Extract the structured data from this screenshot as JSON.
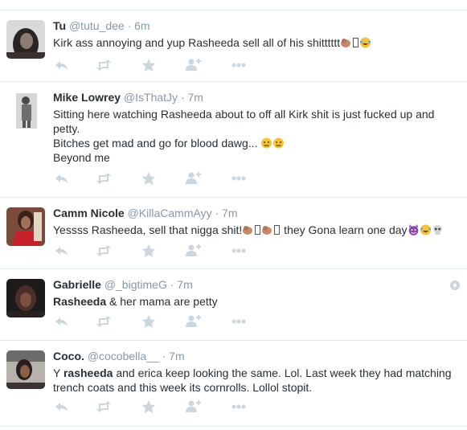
{
  "colors": {
    "text": "#292f33",
    "muted": "#8899a6",
    "action": "#ccd6dd",
    "divider": "#e1e8ed"
  },
  "tweets": [
    {
      "fullname": "Tu",
      "username": "@tutu_dee",
      "separator": "·",
      "time": "6m",
      "text": "Kirk ass annoying and yup Rasheeda sell all of his shitttttt",
      "avatar_icon": "avatar-photo-dark-hair",
      "emojis": [
        "clapping-hands-emoji",
        "box-glyph",
        "laughing-tears-emoji"
      ]
    },
    {
      "fullname": "Mike Lowrey",
      "username": "@IsThatJy",
      "separator": "·",
      "time": "7m",
      "text_lines": [
        "Sitting here watching Rasheeda about to off all Kirk shit is just fucked up and",
        "petty.",
        "Bitches get mad and go for blood dawg...",
        "Beyond me"
      ],
      "avatar_icon": "avatar-photo-grayscale",
      "emojis": [
        "neutral-face-emoji",
        "neutral-face-emoji"
      ]
    },
    {
      "fullname": "Camm Nicole",
      "username": "@KillaCammAyy",
      "separator": "·",
      "time": "7m",
      "text_a": "Yessss Rasheeda, sell that nigga shit!",
      "text_b": " they Gona learn one day",
      "avatar_icon": "avatar-photo-red-outfit",
      "emojis": [
        "clapping-hands-emoji",
        "box-glyph",
        "clapping-hands-emoji",
        "box-glyph",
        "imp-emoji",
        "laughing-tears-emoji",
        "skull-emoji"
      ]
    },
    {
      "fullname": "Gabrielle",
      "username": "@_bigtimeG",
      "separator": "·",
      "time": "7m",
      "text_bold": "Rasheeda",
      "text_rest": " & her mama are petty",
      "avatar_icon": "avatar-photo-dark",
      "extra_icon": "globe-icon"
    },
    {
      "fullname": "Coco.",
      "username": "@cocobella__",
      "separator": "·",
      "time": "7m",
      "text_a": "Y ",
      "text_bold": "rasheeda",
      "text_b": " and erica keep looking the same. Lol. Last week they had matching",
      "text_line2": "trench coats and this week its cornrolls. Lollol stopit.",
      "avatar_icon": "avatar-photo-car-selfie"
    }
  ],
  "action_icons": [
    "reply-icon",
    "retweet-icon",
    "favorite-star-icon",
    "follow-person-icon",
    "more-dots-icon"
  ]
}
